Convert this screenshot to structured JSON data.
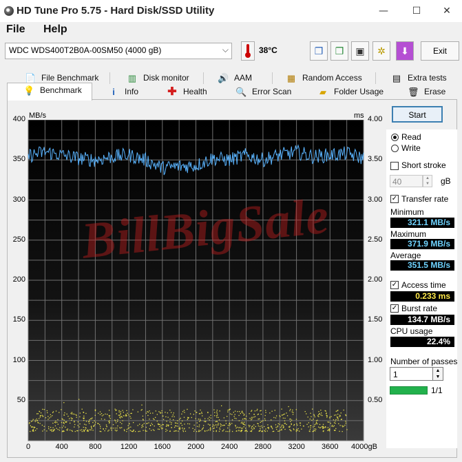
{
  "window": {
    "title": "HD Tune Pro 5.75 - Hard Disk/SSD Utility",
    "controls": {
      "minimize": "—",
      "maximize": "☐",
      "close": "✕"
    }
  },
  "menu": {
    "file": "File",
    "help": "Help"
  },
  "toolbar": {
    "drive": "WDC  WDS400T2B0A-00SM50 (4000 gB)",
    "temperature": "38°C",
    "exit_label": "Exit",
    "icons": [
      "copy-info-icon",
      "copy-screen-icon",
      "screenshot-icon",
      "options-icon",
      "download-icon"
    ]
  },
  "tabs": {
    "row1": [
      {
        "label": "File Benchmark",
        "icon": "file-benchmark-icon"
      },
      {
        "label": "Disk monitor",
        "icon": "disk-monitor-icon"
      },
      {
        "label": "AAM",
        "icon": "speaker-icon"
      },
      {
        "label": "Random Access",
        "icon": "random-access-icon"
      },
      {
        "label": "Extra tests",
        "icon": "extra-tests-icon"
      }
    ],
    "row2": [
      {
        "label": "Benchmark",
        "icon": "benchmark-icon"
      },
      {
        "label": "Info",
        "icon": "info-icon"
      },
      {
        "label": "Health",
        "icon": "health-icon"
      },
      {
        "label": "Error Scan",
        "icon": "error-scan-icon"
      },
      {
        "label": "Folder Usage",
        "icon": "folder-usage-icon"
      },
      {
        "label": "Erase",
        "icon": "erase-icon"
      }
    ],
    "active": "Benchmark"
  },
  "chart_data": {
    "type": "line",
    "left_unit": "MB/s",
    "right_unit": "ms",
    "y_ticks": [
      400,
      350,
      300,
      250,
      200,
      150,
      100,
      50
    ],
    "y2_ticks": [
      "4.00",
      "3.50",
      "3.00",
      "2.50",
      "2.00",
      "1.50",
      "1.00",
      "0.50"
    ],
    "x_ticks": [
      "0",
      "400",
      "800",
      "1200",
      "1600",
      "2000",
      "2400",
      "2800",
      "3200",
      "3600",
      "4000gB"
    ],
    "xlim": [
      0,
      4000
    ],
    "ylim": [
      0,
      400
    ],
    "y2lim": [
      0,
      4
    ],
    "grid": true,
    "series": [
      {
        "color": "#5ab4ff",
        "x": [
          0,
          200,
          400,
          600,
          800,
          1000,
          1200,
          1400,
          1600,
          1800,
          2000,
          2200,
          2400,
          2600,
          2800,
          3000,
          3200,
          3400,
          3600,
          3800,
          4000
        ],
        "y": [
          355,
          360,
          356,
          352,
          350,
          354,
          356,
          350,
          340,
          342,
          343,
          352,
          350,
          356,
          350,
          356,
          360,
          354,
          356,
          358,
          352
        ],
        "noise": 9
      }
    ],
    "access_time_points": {
      "color": "#e8e04a",
      "count": 900,
      "ms_min": 0.12,
      "ms_max": 0.4,
      "x_max": 3800
    }
  },
  "watermark": "BillBigSale",
  "panel": {
    "start_label": "Start",
    "read_label": "Read",
    "write_label": "Write",
    "mode": "read",
    "short_stroke_label": "Short stroke",
    "short_stroke_value": "40",
    "short_stroke_unit": "gB",
    "transfer_rate_label": "Transfer rate",
    "minimum_label": "Minimum",
    "minimum_value": "321.1 MB/s",
    "maximum_label": "Maximum",
    "maximum_value": "371.9 MB/s",
    "average_label": "Average",
    "average_value": "351.5 MB/s",
    "access_time_label": "Access time",
    "access_time_value": "0.233 ms",
    "burst_rate_label": "Burst rate",
    "burst_rate_value": "134.7 MB/s",
    "cpu_usage_label": "CPU usage",
    "cpu_usage_value": "22.4%",
    "passes_label": "Number of passes",
    "passes_value": "1",
    "progress_text": "1/1",
    "progress_fraction": 1.0
  }
}
